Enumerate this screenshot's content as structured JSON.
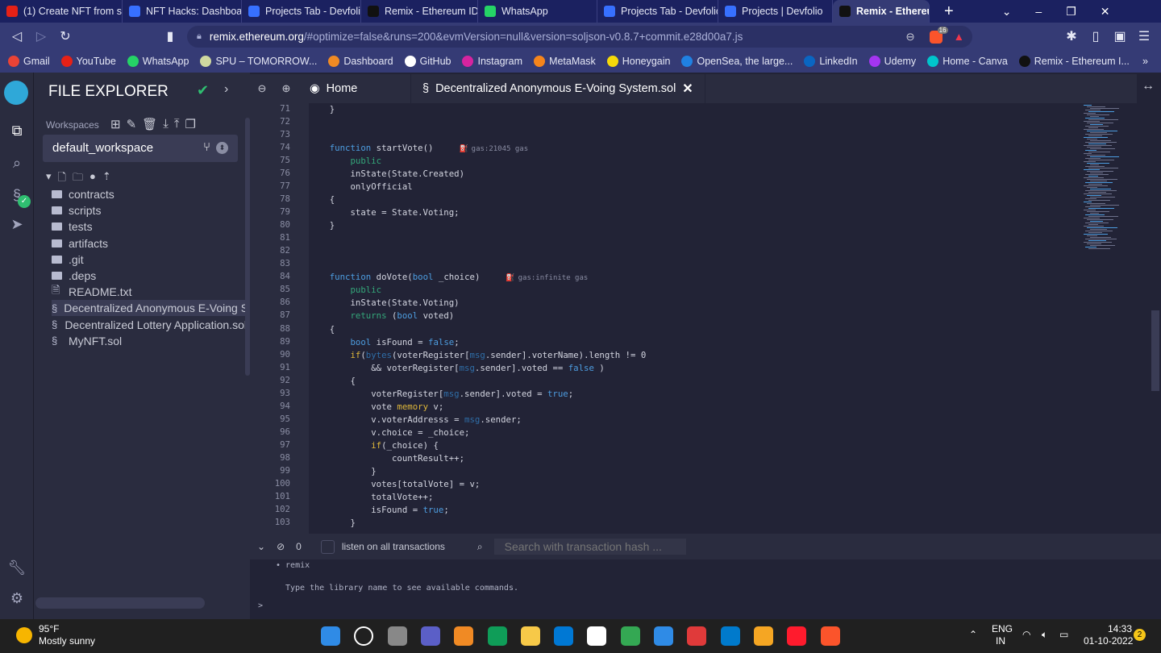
{
  "browser": {
    "tabs": [
      {
        "label": "(1) Create NFT from sc",
        "color": "#e62117"
      },
      {
        "label": "NFT Hacks: Dashboard",
        "color": "#3770ff"
      },
      {
        "label": "Projects Tab - Devfolio",
        "color": "#3770ff"
      },
      {
        "label": "Remix - Ethereum IDE",
        "color": "#111111"
      },
      {
        "label": "WhatsApp",
        "color": "#25d366"
      },
      {
        "label": "Projects Tab - Devfolio",
        "color": "#3770ff"
      },
      {
        "label": "Projects | Devfolio",
        "color": "#3770ff"
      },
      {
        "label": "Remix - Ethereum",
        "color": "#111111",
        "active": true
      }
    ],
    "url_host": "remix.ethereum.org",
    "url_rest": "/#optimize=false&runs=200&evmVersion=null&version=soljson-v0.8.7+commit.e28d00a7.js",
    "brave_badge": "16",
    "bookmarks": [
      {
        "label": "Gmail",
        "color": "#ea4335"
      },
      {
        "label": "YouTube",
        "color": "#e62117"
      },
      {
        "label": "WhatsApp",
        "color": "#25d366"
      },
      {
        "label": "SPU – TOMORROW...",
        "color": "#cfd8a0"
      },
      {
        "label": "Dashboard",
        "color": "#f08a24"
      },
      {
        "label": "GitHub",
        "color": "#ffffff"
      },
      {
        "label": "Instagram",
        "color": "#d6249f"
      },
      {
        "label": "MetaMask",
        "color": "#f6851b"
      },
      {
        "label": "Honeygain",
        "color": "#f5d90a"
      },
      {
        "label": "OpenSea, the large...",
        "color": "#2081e2"
      },
      {
        "label": "LinkedIn",
        "color": "#0a66c2"
      },
      {
        "label": "Udemy",
        "color": "#a435f0"
      },
      {
        "label": "Home - Canva",
        "color": "#00c4cc"
      },
      {
        "label": "Remix - Ethereum I...",
        "color": "#111111"
      }
    ],
    "more": "»"
  },
  "remix": {
    "panel_title": "FILE EXPLORER",
    "workspaces_label": "Workspaces",
    "workspace": "default_workspace",
    "files": [
      {
        "name": "contracts",
        "type": "folder"
      },
      {
        "name": "scripts",
        "type": "folder"
      },
      {
        "name": "tests",
        "type": "folder"
      },
      {
        "name": "artifacts",
        "type": "folder"
      },
      {
        "name": ".git",
        "type": "folder"
      },
      {
        "name": ".deps",
        "type": "folder"
      },
      {
        "name": "README.txt",
        "type": "file"
      },
      {
        "name": "Decentralized Anonymous E-Voing System.sol",
        "type": "sol",
        "selected": true
      },
      {
        "name": "Decentralized Lottery Application.sol",
        "type": "sol"
      },
      {
        "name": "MyNFT.sol",
        "type": "sol"
      }
    ],
    "editor_tabs": [
      {
        "label": "Home"
      },
      {
        "label": "Decentralized Anonymous E-Voing System.sol",
        "active": true
      }
    ],
    "first_line": 71,
    "code": [
      [
        [
          "    }",
          "p"
        ]
      ],
      [],
      [],
      [
        [
          "    ",
          "p"
        ],
        [
          "function",
          "k"
        ],
        [
          " startVote()",
          "p"
        ],
        [
          "gas:21045 gas",
          "gas"
        ]
      ],
      [
        [
          "        ",
          "p"
        ],
        [
          "public",
          "g"
        ]
      ],
      [
        [
          "        inState(State.Created)",
          "p"
        ]
      ],
      [
        [
          "        onlyOfficial",
          "p"
        ]
      ],
      [
        [
          "    {",
          "p"
        ]
      ],
      [
        [
          "        state = State.Voting;",
          "p"
        ]
      ],
      [
        [
          "    }",
          "p"
        ]
      ],
      [],
      [],
      [],
      [
        [
          "    ",
          "p"
        ],
        [
          "function",
          "k"
        ],
        [
          " doVote(",
          "p"
        ],
        [
          "bool",
          "k"
        ],
        [
          " _choice)",
          "p"
        ],
        [
          "gas:infinite gas",
          "gas"
        ]
      ],
      [
        [
          "        ",
          "p"
        ],
        [
          "public",
          "g"
        ]
      ],
      [
        [
          "        inState(State.Voting)",
          "p"
        ]
      ],
      [
        [
          "        ",
          "p"
        ],
        [
          "returns",
          "g"
        ],
        [
          " (",
          "p"
        ],
        [
          "bool",
          "k"
        ],
        [
          " voted)",
          "p"
        ]
      ],
      [
        [
          "    {",
          "p"
        ]
      ],
      [
        [
          "        ",
          "p"
        ],
        [
          "bool",
          "k"
        ],
        [
          " isFound = ",
          "p"
        ],
        [
          "false",
          "k"
        ],
        [
          ";",
          "p"
        ]
      ],
      [
        [
          "        ",
          "p"
        ],
        [
          "if",
          "y"
        ],
        [
          "(",
          "p"
        ],
        [
          "bytes",
          "m"
        ],
        [
          "(voterRegister[",
          "p"
        ],
        [
          "msg",
          "m"
        ],
        [
          ".sender].voterName).length != 0",
          "p"
        ]
      ],
      [
        [
          "            && voterRegister[",
          "p"
        ],
        [
          "msg",
          "m"
        ],
        [
          ".sender].voted == ",
          "p"
        ],
        [
          "false",
          "k"
        ],
        [
          " )",
          "p"
        ]
      ],
      [
        [
          "        {",
          "p"
        ]
      ],
      [
        [
          "            voterRegister[",
          "p"
        ],
        [
          "msg",
          "m"
        ],
        [
          ".sender].voted = ",
          "p"
        ],
        [
          "true",
          "k"
        ],
        [
          ";",
          "p"
        ]
      ],
      [
        [
          "            vote ",
          "p"
        ],
        [
          "memory",
          "y"
        ],
        [
          " v;",
          "p"
        ]
      ],
      [
        [
          "            v.voterAddresss = ",
          "p"
        ],
        [
          "msg",
          "m"
        ],
        [
          ".sender;",
          "p"
        ]
      ],
      [
        [
          "            v.choice = _choice;",
          "p"
        ]
      ],
      [
        [
          "            ",
          "p"
        ],
        [
          "if",
          "y"
        ],
        [
          "(_choice) {",
          "p"
        ]
      ],
      [
        [
          "                countResult++;",
          "p"
        ]
      ],
      [
        [
          "            }",
          "p"
        ]
      ],
      [
        [
          "            votes[totalVote] = v;",
          "p"
        ]
      ],
      [
        [
          "            totalVote++;",
          "p"
        ]
      ],
      [
        [
          "            isFound = ",
          "p"
        ],
        [
          "true",
          "k"
        ],
        [
          ";",
          "p"
        ]
      ],
      [
        [
          "        }",
          "p"
        ]
      ]
    ],
    "terminal": {
      "count": "0",
      "listen_label": "listen on all transactions",
      "search_placeholder": "Search with transaction hash ...",
      "lines": [
        "• remix",
        "",
        "Type the library name to see available commands."
      ],
      "prompt": ">"
    }
  },
  "taskbar": {
    "weather_temp": "95°F",
    "weather_desc": "Mostly sunny",
    "lang1": "ENG",
    "lang2": "IN",
    "time": "14:33",
    "date": "01-10-2022",
    "notifications": "2"
  }
}
